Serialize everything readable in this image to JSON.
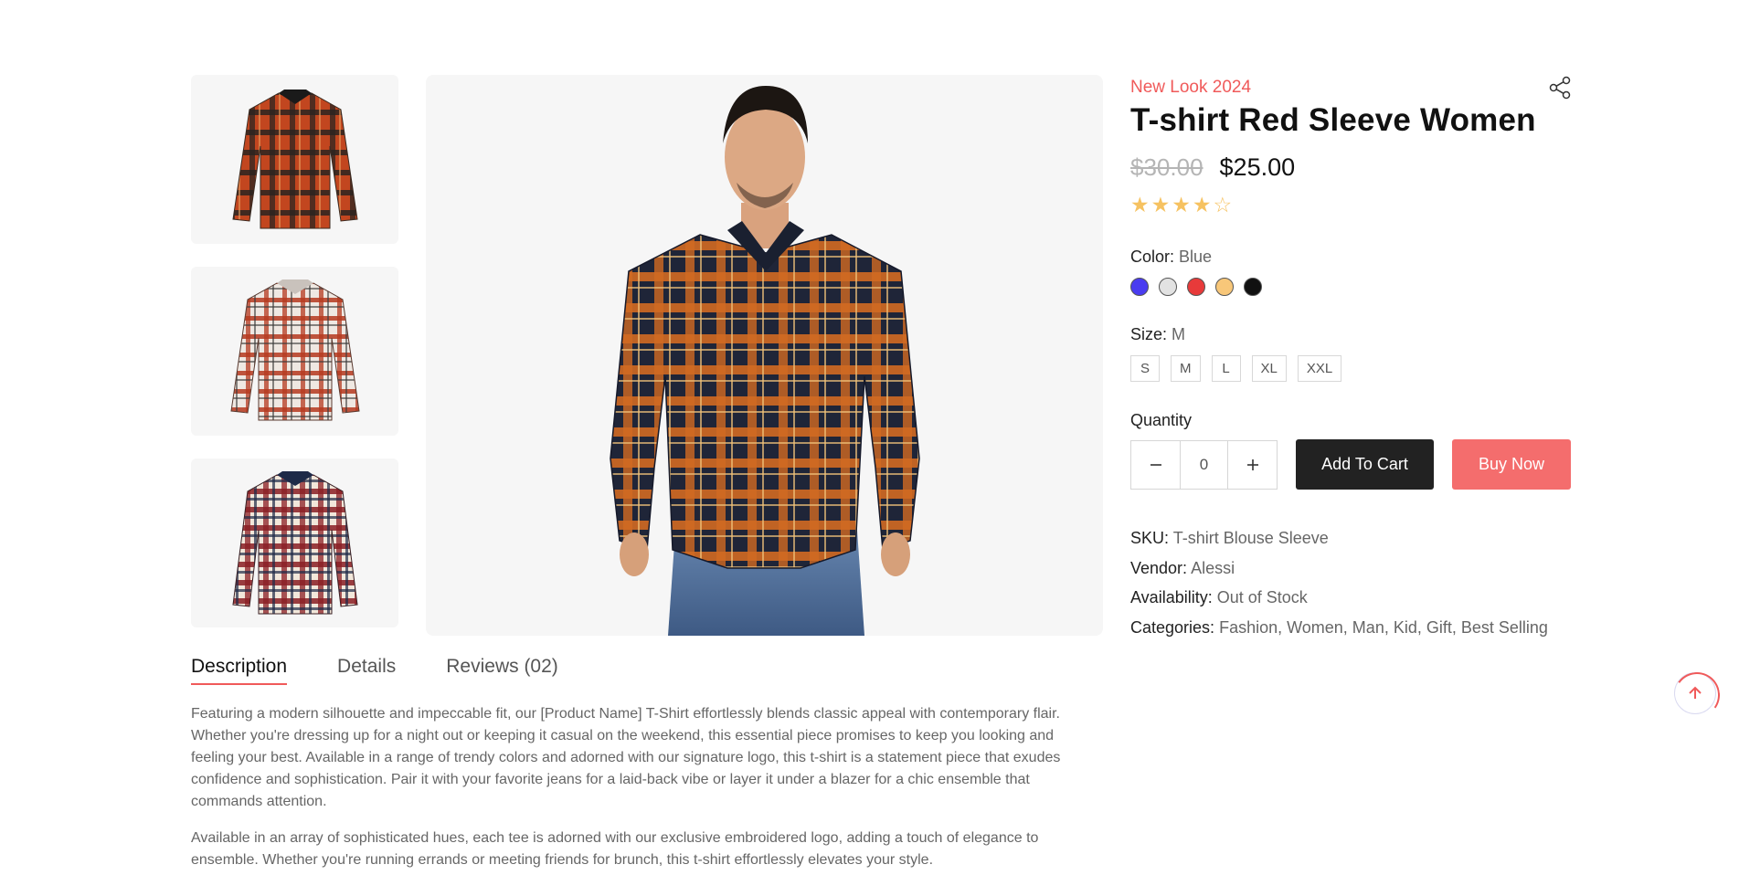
{
  "product": {
    "subtitle": "New Look 2024",
    "title": "T-shirt Red Sleeve Women",
    "old_price": "$30.00",
    "price": "$25.00",
    "rating": 4,
    "rating_max": 5,
    "color_label": "Color:",
    "color_value": "Blue",
    "colors": [
      "#4a3cf0",
      "#e2e2e2",
      "#e83a3a",
      "#f8c779",
      "#111111"
    ],
    "size_label": "Size:",
    "size_value": "M",
    "sizes": [
      "S",
      "M",
      "L",
      "XL",
      "XXL"
    ],
    "quantity_label": "Quantity",
    "quantity_value": "0",
    "add_to_cart": "Add To Cart",
    "buy_now": "Buy Now",
    "meta": {
      "sku_label": "SKU:",
      "sku": "T-shirt Blouse Sleeve",
      "vendor_label": "Vendor:",
      "vendor": "Alessi",
      "availability_label": "Availability:",
      "availability": "Out of Stock",
      "categories_label": "Categories:",
      "categories": "Fashion, Women, Man, Kid, Gift, Best Selling"
    }
  },
  "icons": {
    "share": "share-icon",
    "minus": "minus-icon",
    "plus": "plus-icon",
    "back_to_top": "arrow-up-icon"
  },
  "tabs": [
    "Description",
    "Details",
    "Reviews (02)"
  ],
  "active_tab": 0,
  "description": [
    "Featuring a modern silhouette and impeccable fit, our [Product Name] T-Shirt effortlessly blends classic appeal with contemporary flair. Whether you're dressing up for a night out or keeping it casual on the weekend, this essential piece promises to keep you looking and feeling your best. Available in a range of trendy colors and adorned with our signature logo, this t-shirt is a statement piece that exudes confidence and sophistication. Pair it with your favorite jeans for a laid-back vibe or layer it under a blazer for a chic ensemble that commands attention.",
    "Available in an array of sophisticated hues, each tee is adorned with our exclusive embroidered logo, adding a touch of elegance to ensemble. Whether you're running errands or meeting friends for brunch, this t-shirt effortlessly elevates your style."
  ],
  "colors": {
    "accent": "#f05a5a",
    "star": "#f6c261",
    "dark_button": "#222222",
    "buy_button": "#f46d6d"
  }
}
